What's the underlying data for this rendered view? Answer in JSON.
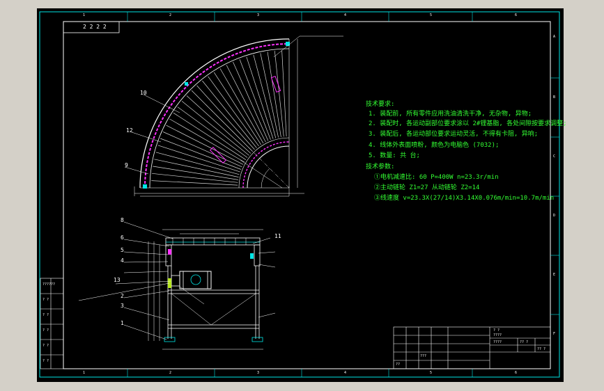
{
  "colors": {
    "background": "#000000",
    "frame": "#00e5e5",
    "notes": "#33ff33",
    "dims": "#ffffff",
    "highlight": "#ff33ff",
    "window": "#d4d0c8"
  },
  "frame": {
    "top_ticks": [
      "1",
      "2",
      "3",
      "4",
      "5",
      "6"
    ],
    "bottom_ticks": [
      "1",
      "2",
      "3",
      "4",
      "5",
      "6"
    ],
    "right_ticks": [
      "A",
      "B",
      "C",
      "D",
      "E",
      "F"
    ],
    "title_corner": "2 2 2 2"
  },
  "notes": {
    "heading": "技术要求:",
    "items": [
      "1. 装配前, 所有零件应用洗油清洗干净, 无杂物, 异物;",
      "2. 装配时, 各运动副部位要求涂以 2#锂基脂, 各处间隙按要求调整;",
      "3. 装配后, 各运动部位要求运动灵活, 不得有卡阻, 异响;",
      "4. 线体外表面喷粉, 颜色为电脑色 (7032);",
      "5. 数量: 共 台;"
    ],
    "params_heading": "技术参数:",
    "params": [
      "①电机减速比: 60 P=400W n=23.3r/min",
      "②主动链轮 Z1=27 从动链轮 Z2=14",
      "③线速度 v=23.3X(27/14)X3.14X0.076m/min=10.7m/min"
    ]
  },
  "callouts": {
    "plan": [
      "10",
      "12",
      "9"
    ],
    "elevation": [
      "8",
      "6",
      "5",
      "4",
      "13",
      "2",
      "3",
      "1",
      "11"
    ]
  },
  "left_table": [
    "??????",
    "? ?",
    "? ?",
    "? ?",
    "? ?",
    "? ?"
  ],
  "title_block": {
    "cells": [
      "? ?",
      "????",
      "????",
      "?? ?",
      "?? ?",
      "???",
      "??"
    ]
  }
}
